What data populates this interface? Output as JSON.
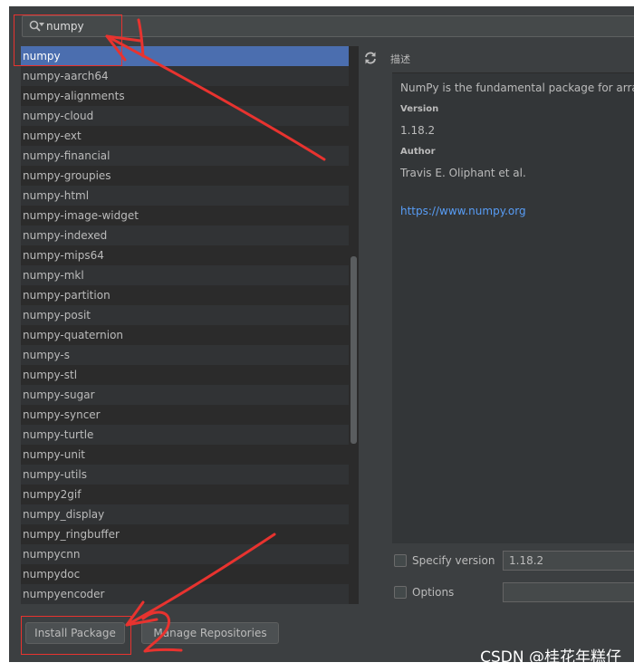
{
  "search": {
    "value": "numpy",
    "icon": "search-icon"
  },
  "packages": [
    "numpy",
    "numpy-aarch64",
    "numpy-alignments",
    "numpy-cloud",
    "numpy-ext",
    "numpy-financial",
    "numpy-groupies",
    "numpy-html",
    "numpy-image-widget",
    "numpy-indexed",
    "numpy-mips64",
    "numpy-mkl",
    "numpy-partition",
    "numpy-posit",
    "numpy-quaternion",
    "numpy-s",
    "numpy-stl",
    "numpy-sugar",
    "numpy-syncer",
    "numpy-turtle",
    "numpy-unit",
    "numpy-utils",
    "numpy2gif",
    "numpy_display",
    "numpy_ringbuffer",
    "numpycnn",
    "numpydoc",
    "numpyencoder"
  ],
  "selected_package": "numpy",
  "description": {
    "label": "描述",
    "summary": "NumPy is the fundamental package for array co",
    "version_heading": "Version",
    "version": "1.18.2",
    "author_heading": "Author",
    "author": "Travis E. Oliphant et al.",
    "url": "https://www.numpy.org"
  },
  "options": {
    "specify_version_label": "Specify version",
    "specify_version_value": "1.18.2",
    "options_label": "Options",
    "options_value": ""
  },
  "buttons": {
    "install": "Install Package",
    "manage": "Manage Repositories"
  },
  "watermark": "CSDN @桂花年糕仔",
  "colors": {
    "background": "#3c3f41",
    "selection": "#4b6eaf",
    "link": "#589df6",
    "annotation": "#e8332f"
  }
}
